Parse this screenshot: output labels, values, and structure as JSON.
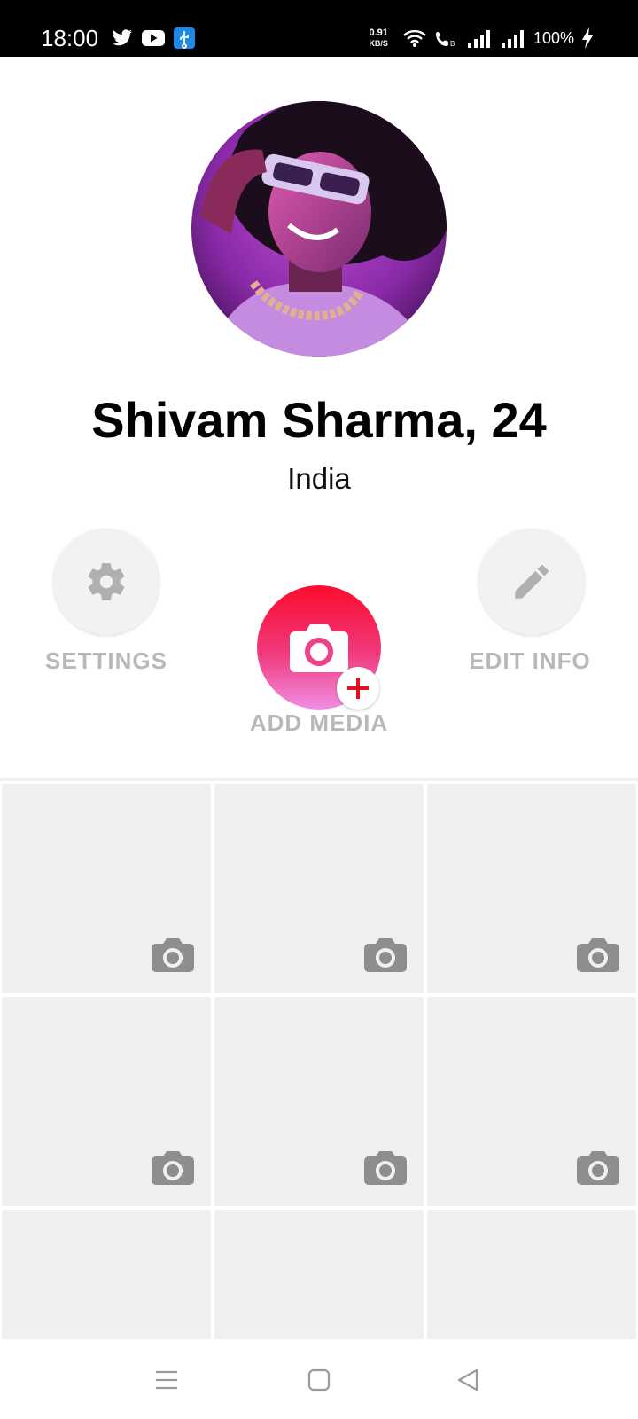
{
  "status_bar": {
    "time": "18:00",
    "icons_left": [
      "twitter-icon",
      "youtube-icon",
      "usb-icon"
    ],
    "speed_value": "0.91",
    "speed_unit": "KB/S",
    "battery": "100%"
  },
  "profile": {
    "name": "Shivam Sharma, 24",
    "location": "India"
  },
  "actions": {
    "settings_label": "SETTINGS",
    "add_media_label": "ADD MEDIA",
    "edit_info_label": "EDIT INFO"
  },
  "media_grid": {
    "slots": 9,
    "placeholder_icon": "camera-icon"
  },
  "colors": {
    "accent_top": "#fb0c2e",
    "accent_bottom": "#f08ee6",
    "label_gray": "#b8b8b8"
  }
}
